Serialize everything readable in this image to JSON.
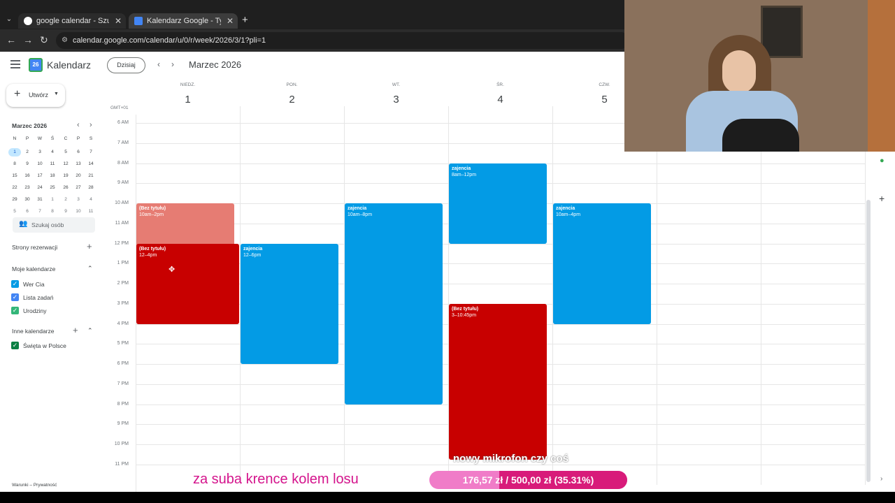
{
  "browser": {
    "tabs": [
      {
        "title": "google calendar - Szukaj w Google"
      },
      {
        "title": "Kalendarz Google - Tydzień, w"
      }
    ],
    "url": "calendar.google.com/calendar/u/0/r/week/2026/3/1?pli=1",
    "new_tab_label": "+"
  },
  "app": {
    "name": "Kalendarz",
    "logo_day": "26",
    "today_button": "Dzisiaj",
    "current_period": "Marzec 2026",
    "create_button": "Utwórz",
    "timezone": "GMT+01"
  },
  "week_days": [
    {
      "abbr": "NIEDZ.",
      "num": "1"
    },
    {
      "abbr": "PON.",
      "num": "2"
    },
    {
      "abbr": "WT.",
      "num": "3"
    },
    {
      "abbr": "ŚR.",
      "num": "4"
    },
    {
      "abbr": "CZW.",
      "num": "5"
    }
  ],
  "hours": [
    "6 AM",
    "7 AM",
    "8 AM",
    "9 AM",
    "10 AM",
    "11 AM",
    "12 PM",
    "1 PM",
    "2 PM",
    "3 PM",
    "4 PM",
    "5 PM",
    "6 PM",
    "7 PM",
    "8 PM",
    "9 PM",
    "10 PM",
    "11 PM"
  ],
  "mini_calendar": {
    "title": "Marzec 2026",
    "weekday_letters": [
      "N",
      "P",
      "W",
      "Ś",
      "C",
      "P",
      "S"
    ],
    "rows": [
      [
        "1",
        "2",
        "3",
        "4",
        "5",
        "6",
        "7"
      ],
      [
        "8",
        "9",
        "10",
        "11",
        "12",
        "13",
        "14"
      ],
      [
        "15",
        "16",
        "17",
        "18",
        "19",
        "20",
        "21"
      ],
      [
        "22",
        "23",
        "24",
        "25",
        "26",
        "27",
        "28"
      ],
      [
        "29",
        "30",
        "31",
        "1",
        "2",
        "3",
        "4"
      ],
      [
        "5",
        "6",
        "7",
        "8",
        "9",
        "10",
        "11"
      ]
    ]
  },
  "sidebar": {
    "search_people": "Szukaj osób",
    "booking_pages": "Strony rezerwacji",
    "my_calendars": "Moje kalendarze",
    "my_calendar_items": [
      {
        "label": "Wer Cia",
        "color": "#039be5"
      },
      {
        "label": "Lista zadań",
        "color": "#4285f4"
      },
      {
        "label": "Urodziny",
        "color": "#33b679"
      }
    ],
    "other_calendars": "Inne kalendarze",
    "other_calendar_items": [
      {
        "label": "Święta w Polsce",
        "color": "#0b8043"
      }
    ],
    "footer": "Warunki – Prywatność"
  },
  "events": [
    {
      "title": "(Bez tytułu)",
      "time": "10am–2pm",
      "day": 0,
      "start": 10,
      "end": 14,
      "color": "#e67c73"
    },
    {
      "title": "(Bez tytułu)",
      "time": "12–4pm",
      "day": 0,
      "start": 12,
      "end": 16,
      "color": "#c80000"
    },
    {
      "title": "zajencia",
      "time": "12–6pm",
      "day": 1,
      "start": 12,
      "end": 18,
      "color": "#039be5"
    },
    {
      "title": "zajencia",
      "time": "10am–8pm",
      "day": 2,
      "start": 10,
      "end": 20,
      "color": "#039be5"
    },
    {
      "title": "zajencia",
      "time": "8am–12pm",
      "day": 3,
      "start": 8,
      "end": 12,
      "color": "#039be5"
    },
    {
      "title": "(Bez tytułu)",
      "time": "3–10:45pm",
      "day": 3,
      "start": 15,
      "end": 22.75,
      "color": "#c80000"
    },
    {
      "title": "zajencia",
      "time": "10am–4pm",
      "day": 4,
      "start": 10,
      "end": 16,
      "color": "#039be5"
    }
  ],
  "overlay": {
    "caption": "za suba krence kolem losu",
    "goal_label": "nowy mikrofon czy coś",
    "goal_text": "176,57 zł / 500,00 zł (35.31%)",
    "goal_progress": 0.3531
  },
  "colors": {
    "accent": "#1a73e8",
    "caption_color": "#d4148c",
    "goal_bar": "#f07cc8",
    "goal_fill": "#d81b7a"
  }
}
